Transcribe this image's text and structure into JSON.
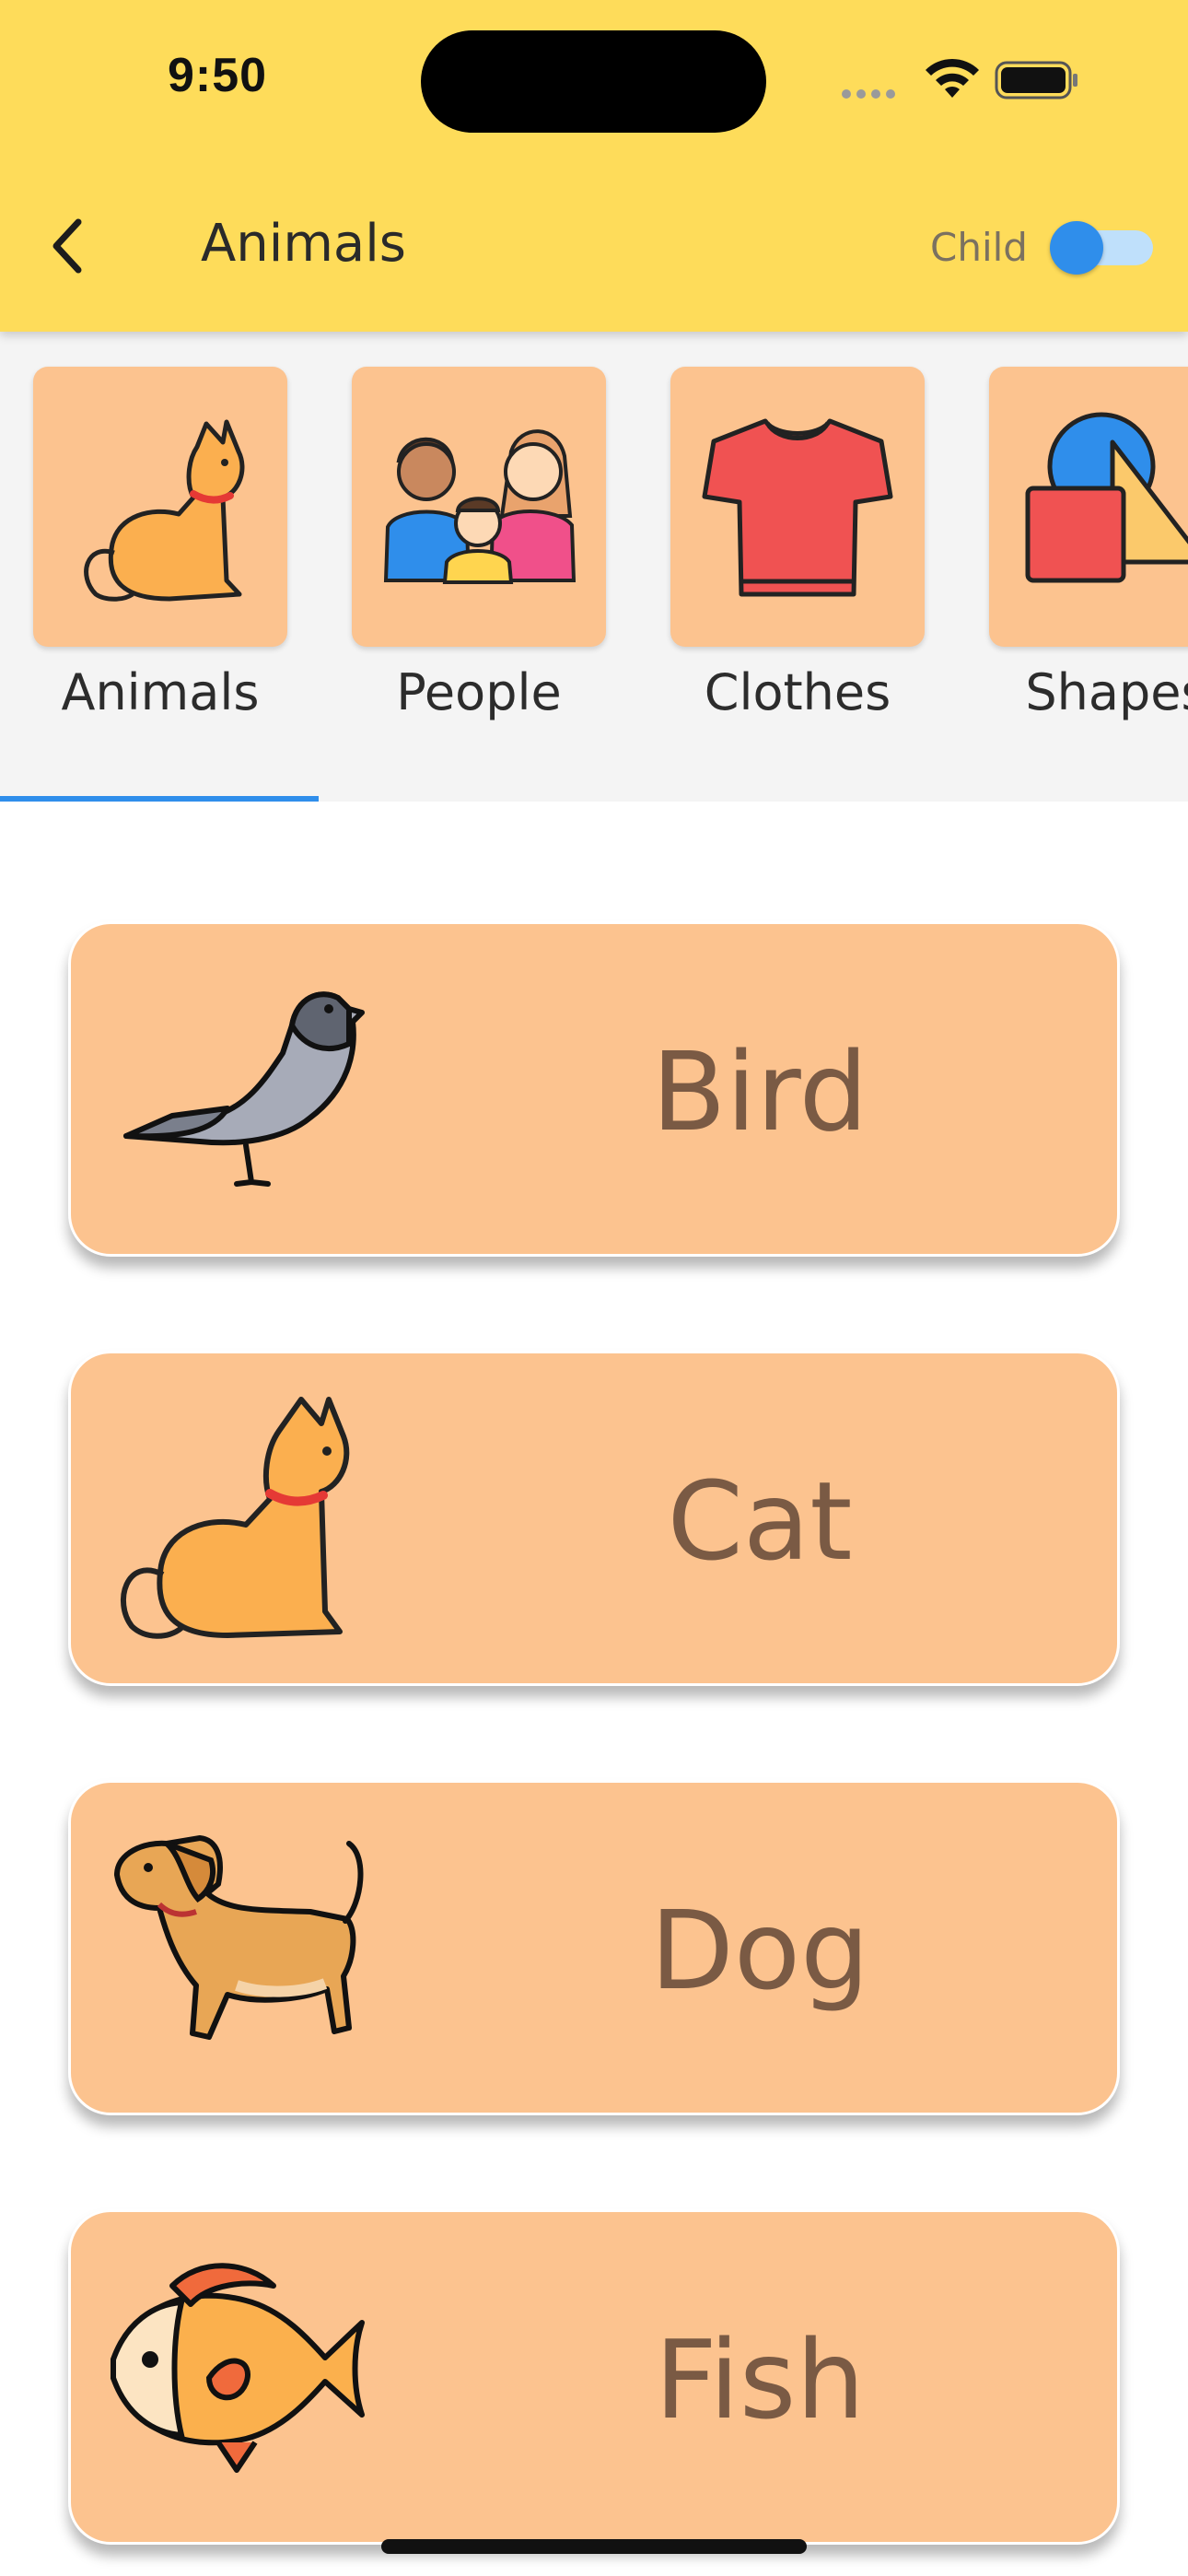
{
  "status_bar": {
    "time": "9:50"
  },
  "header": {
    "title": "Animals",
    "toggle_label": "Child",
    "toggle_on": true,
    "accent": "#2F8EEB",
    "background": "#FEDC5A"
  },
  "categories": [
    {
      "label": "Animals",
      "icon": "cat-icon",
      "selected": true
    },
    {
      "label": "People",
      "icon": "family-icon",
      "selected": false
    },
    {
      "label": "Clothes",
      "icon": "tshirt-icon",
      "selected": false
    },
    {
      "label": "Shapes",
      "icon": "shapes-icon",
      "selected": false
    }
  ],
  "cards": [
    {
      "label": "Bird",
      "icon": "pigeon-icon"
    },
    {
      "label": "Cat",
      "icon": "cat-icon"
    },
    {
      "label": "Dog",
      "icon": "dog-icon"
    },
    {
      "label": "Fish",
      "icon": "fish-icon"
    }
  ],
  "colors": {
    "tile": "#FCC38F",
    "card_text": "#7A5A44"
  }
}
